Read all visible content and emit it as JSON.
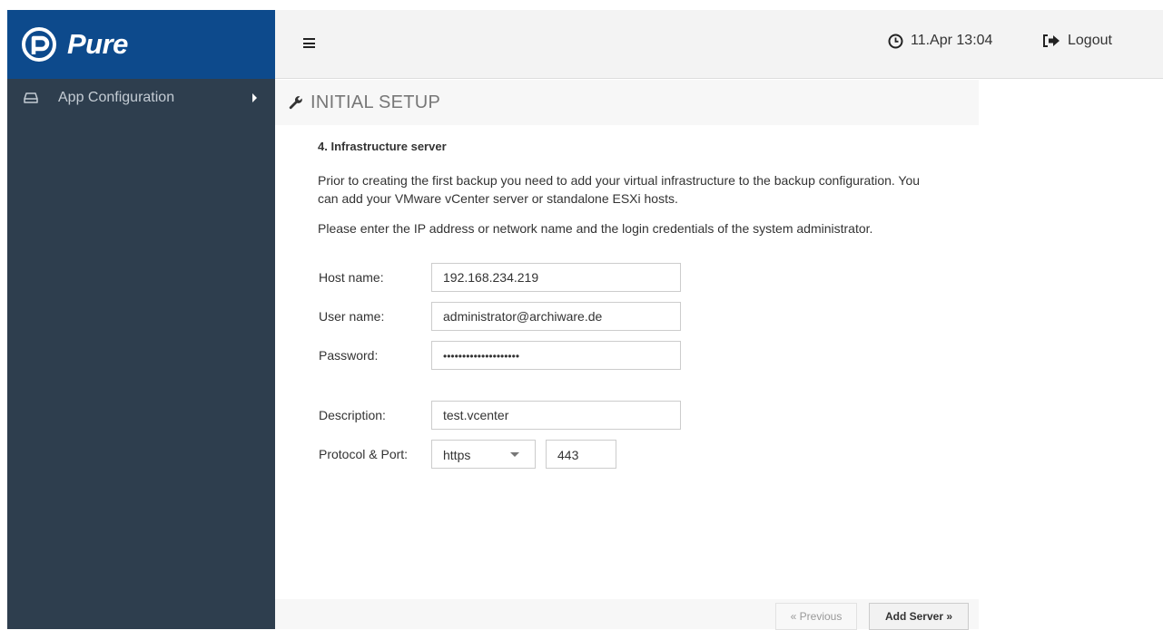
{
  "brand": {
    "name": "Pure"
  },
  "sidebar": {
    "items": [
      {
        "label": "App Configuration",
        "icon": "hard-drive-icon"
      }
    ]
  },
  "topbar": {
    "menu_icon": "hamburger-icon",
    "datetime": "11.Apr 13:04",
    "logout_label": "Logout"
  },
  "page": {
    "title": "INITIAL SETUP",
    "step_title": "4. Infrastructure server",
    "intro": "Prior to creating the first backup you need to add your virtual infrastructure to the backup configuration. You can add your VMware vCenter server or standalone ESXi hosts.",
    "instruction": "Please enter the IP address or network name and the login credentials of the system administrator."
  },
  "form": {
    "host_label": "Host name:",
    "host_value": "192.168.234.219",
    "user_label": "User name:",
    "user_value": "administrator@archiware.de",
    "password_label": "Password:",
    "password_value": "••••••••••••••••••••",
    "description_label": "Description:",
    "description_value": "test.vcenter",
    "protocol_label": "Protocol & Port:",
    "protocol_value": "https",
    "port_value": "443"
  },
  "footer": {
    "previous_label": "« Previous",
    "add_server_label": "Add Server »"
  },
  "colors": {
    "brand_blue": "#0d4a8c",
    "sidebar_bg": "#2e3e4e",
    "topbar_bg": "#f3f3f3"
  }
}
